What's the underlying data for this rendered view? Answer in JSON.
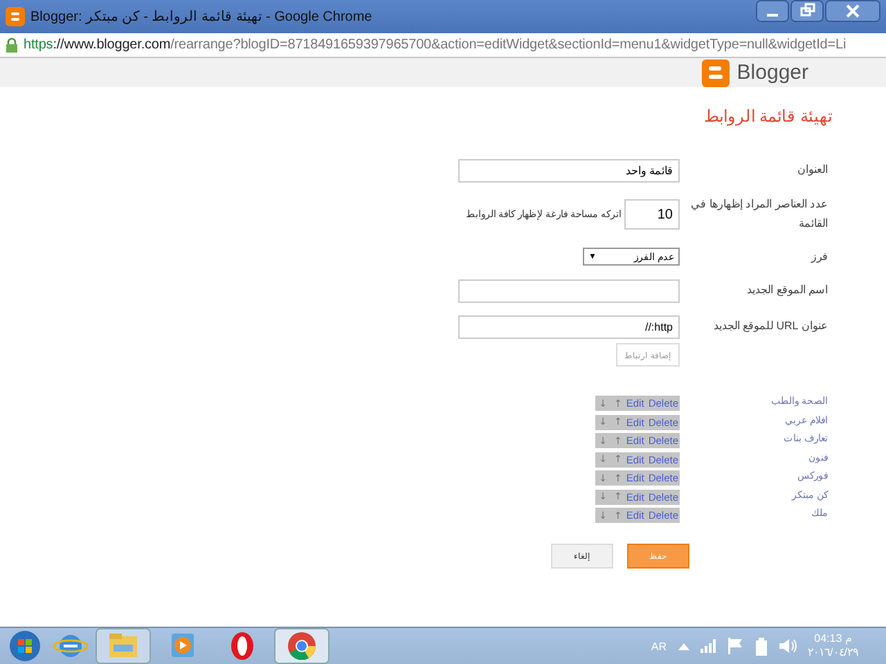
{
  "window": {
    "title": "Blogger: تهيئة قائمة الروابط - كن مبتكر - Google Chrome"
  },
  "address_bar": {
    "scheme": "https",
    "host": "://www.blogger.com",
    "path": "/rearrange?blogID=8718491659397965700&action=editWidget&sectionId=menu1&widgetType=null&widgetId=Li"
  },
  "header": {
    "brand": "Blogger"
  },
  "page_title": "تهيئة قائمة الروابط",
  "form": {
    "fields": [
      {
        "kind": "text",
        "label": "العنوان",
        "value": "قائمة واحد"
      },
      {
        "kind": "number",
        "label": "عدد العناصر المراد إظهارها في القائمة",
        "value": "10",
        "hint": "اتركه مساحة فارغة لإظهار كافة الروابط"
      },
      {
        "kind": "select",
        "label": "فرز",
        "value": "عدم الفرز",
        "arrow": "▼"
      },
      {
        "kind": "text",
        "label": "اسم الموقع الجديد"
      },
      {
        "kind": "text",
        "label": "عنوان URL للموقع الجديد",
        "value": "http://"
      }
    ],
    "add_button": "إضافة ارتباط",
    "links": [
      {
        "name": "الصحة والطب",
        "actions": [
          "Delete",
          "Edit",
          "↑",
          "↓"
        ]
      },
      {
        "name": "افلام عربي",
        "actions": [
          "Delete",
          "Edit",
          "↑",
          "↓"
        ]
      },
      {
        "name": "تعارف بنات",
        "actions": [
          "Delete",
          "Edit",
          "↑",
          "↓"
        ]
      },
      {
        "name": "فنون",
        "actions": [
          "Delete",
          "Edit",
          "↑",
          "↓"
        ]
      },
      {
        "name": "فوركس",
        "actions": [
          "Delete",
          "Edit",
          "↑",
          "↓"
        ]
      },
      {
        "name": "كن مبتكر",
        "actions": [
          "Delete",
          "Edit",
          "↑",
          "↓"
        ]
      },
      {
        "name": "ملك",
        "actions": [
          "Delete",
          "Edit",
          "↑",
          "↓"
        ]
      }
    ],
    "save_button": "حفظ",
    "cancel_button": "إلغاء"
  },
  "taskbar": {
    "language": "AR",
    "time": "04:13 م",
    "date": "٢٠١٦/٠٤/٢٩"
  }
}
